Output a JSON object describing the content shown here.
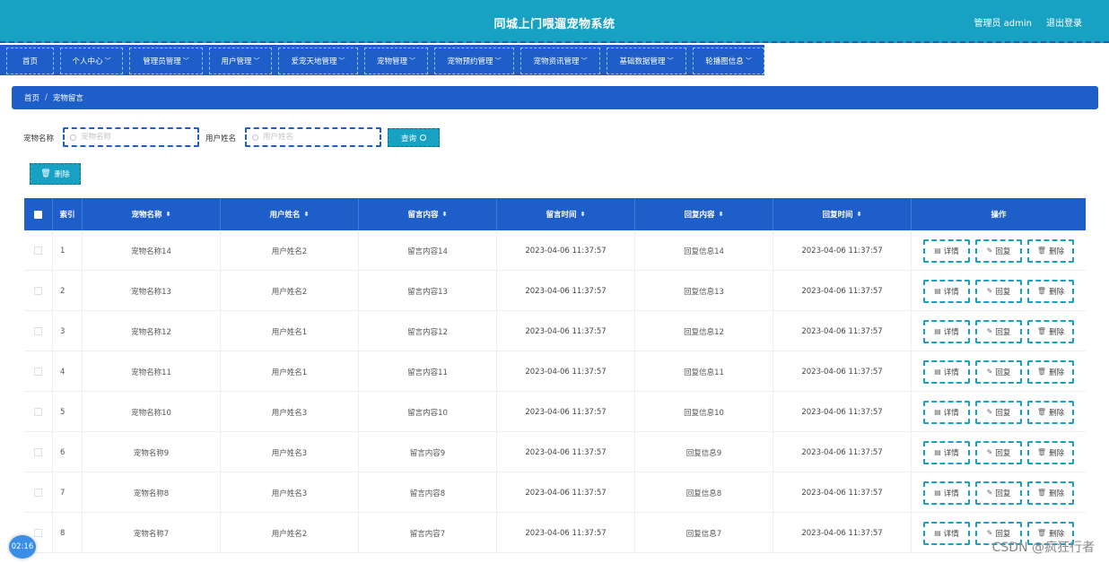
{
  "header": {
    "title": "同城上门喂遛宠物系统",
    "user": "管理员 admin",
    "logout": "退出登录"
  },
  "nav": [
    {
      "label": "首页",
      "dropdown": false
    },
    {
      "label": "个人中心",
      "dropdown": true
    },
    {
      "label": "管理员管理",
      "dropdown": true
    },
    {
      "label": "用户管理",
      "dropdown": true
    },
    {
      "label": "爱宠天地管理",
      "dropdown": true
    },
    {
      "label": "宠物管理",
      "dropdown": true
    },
    {
      "label": "宠物预约管理",
      "dropdown": true
    },
    {
      "label": "宠物资讯管理",
      "dropdown": true
    },
    {
      "label": "基础数据管理",
      "dropdown": true
    },
    {
      "label": "轮播图信息",
      "dropdown": true
    }
  ],
  "breadcrumb": {
    "home": "首页",
    "sep": "/",
    "current": "宠物留言"
  },
  "search": {
    "pet_label": "宠物名称",
    "pet_placeholder": "宠物名称",
    "user_label": "用户姓名",
    "user_placeholder": "用户姓名",
    "query_button": "查询"
  },
  "actions": {
    "delete_button": "删除"
  },
  "table": {
    "columns": {
      "index": "索引",
      "pet": "宠物名称",
      "user": "用户姓名",
      "message": "留言内容",
      "message_time": "留言时间",
      "reply": "回复内容",
      "reply_time": "回复时间",
      "ops": "操作"
    },
    "op_labels": {
      "detail": "详情",
      "reply": "回复",
      "delete": "删除"
    },
    "rows": [
      {
        "index": "1",
        "pet": "宠物名称14",
        "user": "用户姓名2",
        "message": "留言内容14",
        "message_time": "2023-04-06 11:37:57",
        "reply": "回复信息14",
        "reply_time": "2023-04-06 11:37:57"
      },
      {
        "index": "2",
        "pet": "宠物名称13",
        "user": "用户姓名2",
        "message": "留言内容13",
        "message_time": "2023-04-06 11:37:57",
        "reply": "回复信息13",
        "reply_time": "2023-04-06 11:37:57"
      },
      {
        "index": "3",
        "pet": "宠物名称12",
        "user": "用户姓名1",
        "message": "留言内容12",
        "message_time": "2023-04-06 11:37:57",
        "reply": "回复信息12",
        "reply_time": "2023-04-06 11:37:57"
      },
      {
        "index": "4",
        "pet": "宠物名称11",
        "user": "用户姓名1",
        "message": "留言内容11",
        "message_time": "2023-04-06 11:37:57",
        "reply": "回复信息11",
        "reply_time": "2023-04-06 11:37:57"
      },
      {
        "index": "5",
        "pet": "宠物名称10",
        "user": "用户姓名3",
        "message": "留言内容10",
        "message_time": "2023-04-06 11:37:57",
        "reply": "回复信息10",
        "reply_time": "2023-04-06 11:37:57"
      },
      {
        "index": "6",
        "pet": "宠物名称9",
        "user": "用户姓名3",
        "message": "留言内容9",
        "message_time": "2023-04-06 11:37:57",
        "reply": "回复信息9",
        "reply_time": "2023-04-06 11:37:57"
      },
      {
        "index": "7",
        "pet": "宠物名称8",
        "user": "用户姓名3",
        "message": "留言内容8",
        "message_time": "2023-04-06 11:37:57",
        "reply": "回复信息8",
        "reply_time": "2023-04-06 11:37:57"
      },
      {
        "index": "8",
        "pet": "宠物名称7",
        "user": "用户姓名2",
        "message": "留言内容7",
        "message_time": "2023-04-06 11:37:57",
        "reply": "回复信息7",
        "reply_time": "2023-04-06 11:37:57"
      }
    ]
  },
  "overlay": {
    "clock": "02:16",
    "watermark": "CSDN @疯狂行者"
  },
  "icons": {
    "search": "search-icon",
    "trash": "trash-icon",
    "detail": "document-icon",
    "reply": "pen-icon",
    "chevron": "chevron-down-icon",
    "sort": "sort-icon"
  },
  "colors": {
    "header": "#17a2c3",
    "nav": "#1e5ec9",
    "accent": "#17a2c3"
  }
}
